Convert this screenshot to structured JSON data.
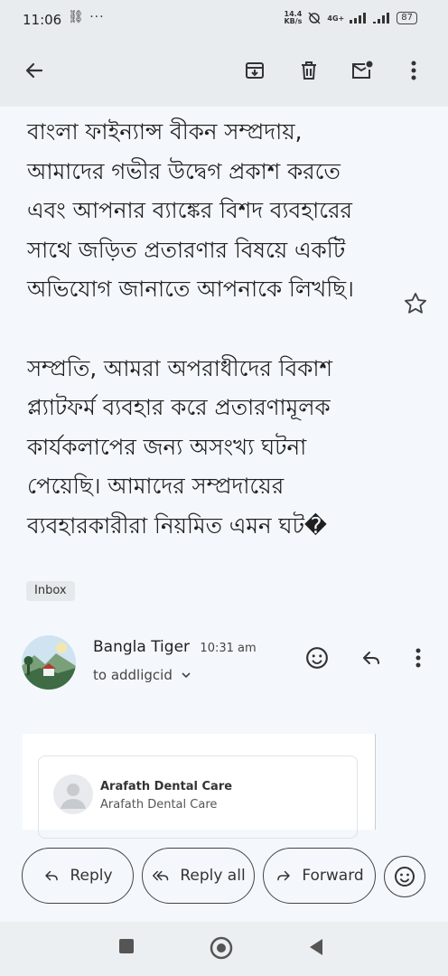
{
  "status": {
    "time": "11:06",
    "left_icons": "⛓ ···",
    "speed_value": "14.4",
    "speed_unit": "KB/s",
    "network": "4G+",
    "battery": "87"
  },
  "toolbar": {
    "back_icon": "arrow-left-icon",
    "archive_icon": "archive-icon",
    "delete_icon": "trash-icon",
    "mark_unread_icon": "mail-unread-icon",
    "more_icon": "more-vert-icon"
  },
  "email": {
    "paragraph1": "বাংলা ফাইন্যান্স বীকন সম্প্রদায়, আমাদের গভীর উদ্বেগ প্রকাশ করতে এবং আপনার ব্যাঙ্কের বিশদ ব্যবহারের সাথে জড়িত প্রতারণার বিষয়ে একটি অভিযোগ জানাতে আপনাকে লিখছি।",
    "paragraph2": "সম্প্রতি, আমরা অপরাধীদের বিকাশ প্ল্যাটফর্ম ব্যবহার করে প্রতারণামূলক কার্যকলাপের জন্য অসংখ্য ঘটনা পেয়েছি। আমাদের সম্প্রদায়ের ব্যবহারকারীরা নিয়মিত এমন ঘট�",
    "label": "Inbox"
  },
  "message": {
    "sender_name": "Bangla Tiger",
    "time": "10:31 am",
    "recipient": "to addligcid",
    "preview_name": "Arafath Dental Care",
    "preview_subname": "Arafath Dental Care"
  },
  "actions": {
    "reply": "Reply",
    "reply_all": "Reply all",
    "forward": "Forward"
  }
}
